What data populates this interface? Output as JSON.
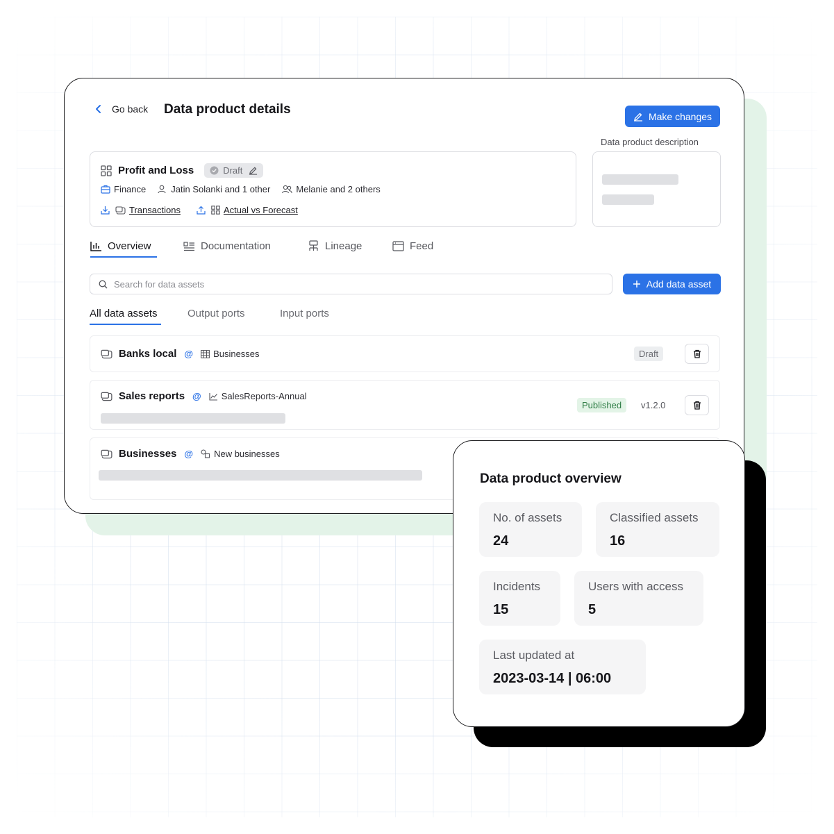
{
  "header": {
    "back_label": "Go back",
    "title": "Data product details",
    "make_changes_label": "Make changes",
    "description_label": "Data product description"
  },
  "product": {
    "name": "Profit and Loss",
    "status": "Draft",
    "domain": "Finance",
    "owners": "Jatin Solanki and 1 other",
    "members": "Melanie and 2 others",
    "input_link": "Transactions",
    "output_link": "Actual vs Forecast"
  },
  "tabs": [
    {
      "label": "Overview",
      "icon": "bar-chart-icon"
    },
    {
      "label": "Documentation",
      "icon": "document-list-icon"
    },
    {
      "label": "Lineage",
      "icon": "lineage-icon"
    },
    {
      "label": "Feed",
      "icon": "feed-icon"
    }
  ],
  "search": {
    "placeholder": "Search for data assets"
  },
  "add_asset_label": "Add data asset",
  "subtabs": [
    "All data assets",
    "Output ports",
    "Input ports"
  ],
  "assets": [
    {
      "name": "Banks local",
      "source": "Businesses",
      "status": "Draft",
      "version": ""
    },
    {
      "name": "Sales reports",
      "source": "SalesReports-Annual",
      "status": "Published",
      "version": "v1.2.0"
    },
    {
      "name": "Businesses",
      "source": "New businesses",
      "status": "",
      "version": ""
    }
  ],
  "overview": {
    "title": "Data product overview",
    "stats": [
      {
        "label": "No. of assets",
        "value": "24"
      },
      {
        "label": "Classified assets",
        "value": "16"
      },
      {
        "label": "Incidents",
        "value": "15"
      },
      {
        "label": "Users with access",
        "value": "5"
      },
      {
        "label": "Last updated at",
        "value": "2023-03-14 | 06:00"
      }
    ]
  },
  "colors": {
    "accent": "#2b72e6",
    "published_bg": "#e3f4e7",
    "published_text": "#2f7d46",
    "shadow_green": "#e3f3e8"
  }
}
